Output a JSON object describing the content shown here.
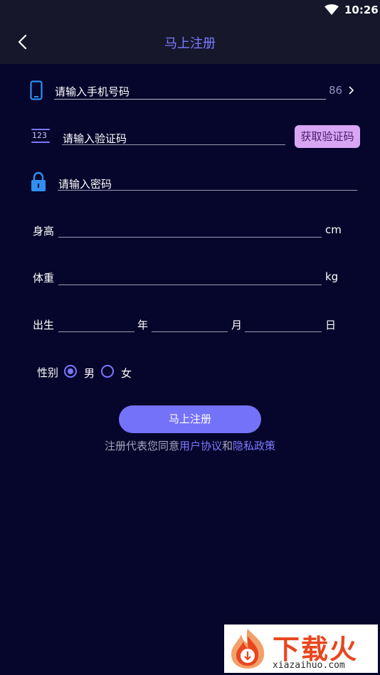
{
  "status_bar": {
    "time": "10:26",
    "wifi_icon": "wifi-icon"
  },
  "header": {
    "title": "马上注册",
    "back_icon": "chevron-left-icon"
  },
  "form": {
    "phone": {
      "placeholder": "请输入手机号码",
      "country_code": "86",
      "icon": "phone-icon"
    },
    "code": {
      "placeholder": "请输入验证码",
      "icon_text": "123",
      "button": "获取验证码"
    },
    "password": {
      "placeholder": "请输入密码",
      "icon": "lock-icon"
    },
    "height": {
      "label": "身高",
      "unit": "cm"
    },
    "weight": {
      "label": "体重",
      "unit": "kg"
    },
    "birth": {
      "label": "出生",
      "year": "年",
      "month": "月",
      "day": "日"
    },
    "gender": {
      "label": "性别",
      "options": [
        {
          "label": "男",
          "selected": true
        },
        {
          "label": "女",
          "selected": false
        }
      ]
    },
    "submit": "马上注册",
    "agreement": {
      "prefix": "注册代表您同意",
      "user_agreement": "用户协议",
      "and": "和",
      "privacy_policy": "隐私政策"
    }
  },
  "watermark": {
    "brand": "下载火",
    "site": "xiazaihuo.com"
  },
  "colors": {
    "background": "#06052b",
    "header": "#16172a",
    "accent": "#7472f8",
    "code_button": "#d8a6f2"
  }
}
